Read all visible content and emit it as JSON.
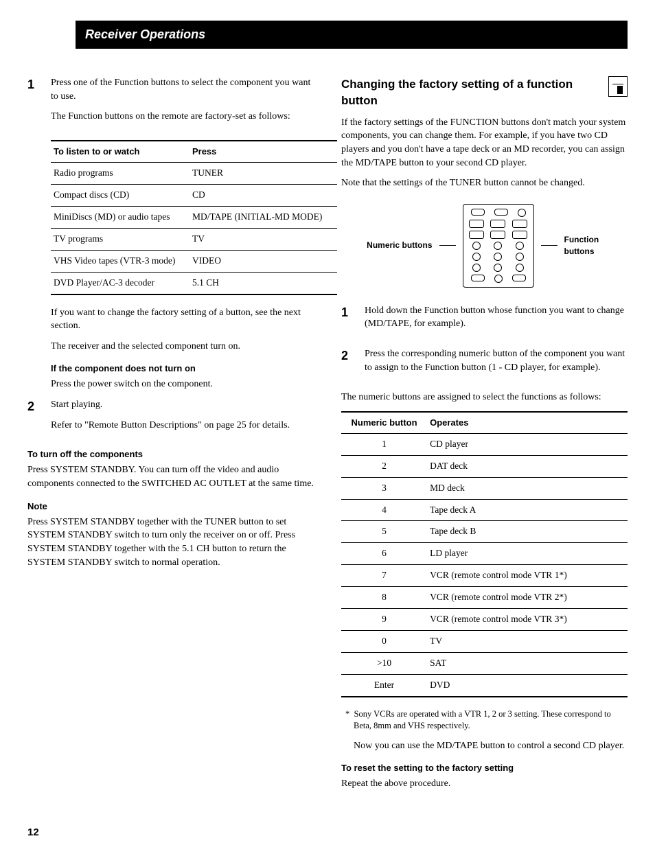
{
  "header": "Receiver Operations",
  "left": {
    "step1_intro": "Press one of the Function buttons to select the component you want to use.",
    "step1_sub": "The Function buttons on the remote are factory-set as follows:",
    "table1": {
      "h1": "To listen to or watch",
      "h2": "Press",
      "rows": [
        {
          "a": "Radio programs",
          "b": "TUNER"
        },
        {
          "a": "Compact discs (CD)",
          "b": "CD"
        },
        {
          "a": "MiniDiscs (MD) or audio tapes",
          "b": "MD/TAPE (INITIAL-MD MODE)"
        },
        {
          "a": "TV programs",
          "b": "TV"
        },
        {
          "a": "VHS Video tapes (VTR-3 mode)",
          "b": "VIDEO"
        },
        {
          "a": "DVD Player/AC-3 decoder",
          "b": "5.1 CH"
        }
      ]
    },
    "after_table1": "If you want to change the factory setting of a button, see the next section.",
    "after_table2": "The receiver and the selected component turn on.",
    "sub_not_on": "If the component does not turn on",
    "sub_not_on_body": "Press the power switch on the component.",
    "step2_a": "Start playing.",
    "step2_b": "Refer to \"Remote Button Descriptions\" on page 25 for details.",
    "turnoff_head": "To turn off the components",
    "turnoff_body": "Press SYSTEM STANDBY. You can turn off the video and audio components connected to the SWITCHED AC OUTLET at the same time.",
    "note_head": "Note",
    "note_body": "Press SYSTEM STANDBY together with the TUNER button to set SYSTEM STANDBY switch to turn only the receiver on or off. Press SYSTEM STANDBY together with the 5.1 CH button to return the SYSTEM STANDBY switch to normal operation."
  },
  "right": {
    "section_title": "Changing the factory setting of a function button",
    "p1": "If the factory settings of the FUNCTION buttons don't match your system components, you can change them. For example, if you have two CD players and you don't have a tape deck or an MD recorder, you can assign the MD/TAPE button to your second CD player.",
    "p2": "Note that the settings of the TUNER button cannot be changed.",
    "label_numeric": "Numeric buttons",
    "label_function": "Function buttons",
    "step1": "Hold down the Function button whose function you want to change (MD/TAPE, for example).",
    "step2": "Press the corresponding numeric button of the component you want to assign to the Function button (1 - CD player, for example).",
    "p3": "The numeric buttons are assigned to select the functions as follows:",
    "table2": {
      "h1": "Numeric button",
      "h2": "Operates",
      "rows": [
        {
          "a": "1",
          "b": "CD player"
        },
        {
          "a": "2",
          "b": "DAT deck"
        },
        {
          "a": "3",
          "b": "MD deck"
        },
        {
          "a": "4",
          "b": "Tape deck A"
        },
        {
          "a": "5",
          "b": "Tape deck B"
        },
        {
          "a": "6",
          "b": "LD player"
        },
        {
          "a": "7",
          "b": "VCR (remote control mode VTR 1*)"
        },
        {
          "a": "8",
          "b": "VCR (remote control mode VTR 2*)"
        },
        {
          "a": "9",
          "b": "VCR (remote control mode VTR 3*)"
        },
        {
          "a": "0",
          "b": "TV"
        },
        {
          "a": ">10",
          "b": "SAT"
        },
        {
          "a": "Enter",
          "b": "DVD"
        }
      ]
    },
    "footnote_mark": "*",
    "footnote": "Sony VCRs are operated with a VTR 1, 2 or 3 setting. These correspond to Beta, 8mm and VHS respectively.",
    "after_foot": "Now you can use the MD/TAPE button to control a second CD player.",
    "reset_head": "To reset the setting to the factory setting",
    "reset_body": "Repeat the above procedure."
  },
  "page_number": "12"
}
